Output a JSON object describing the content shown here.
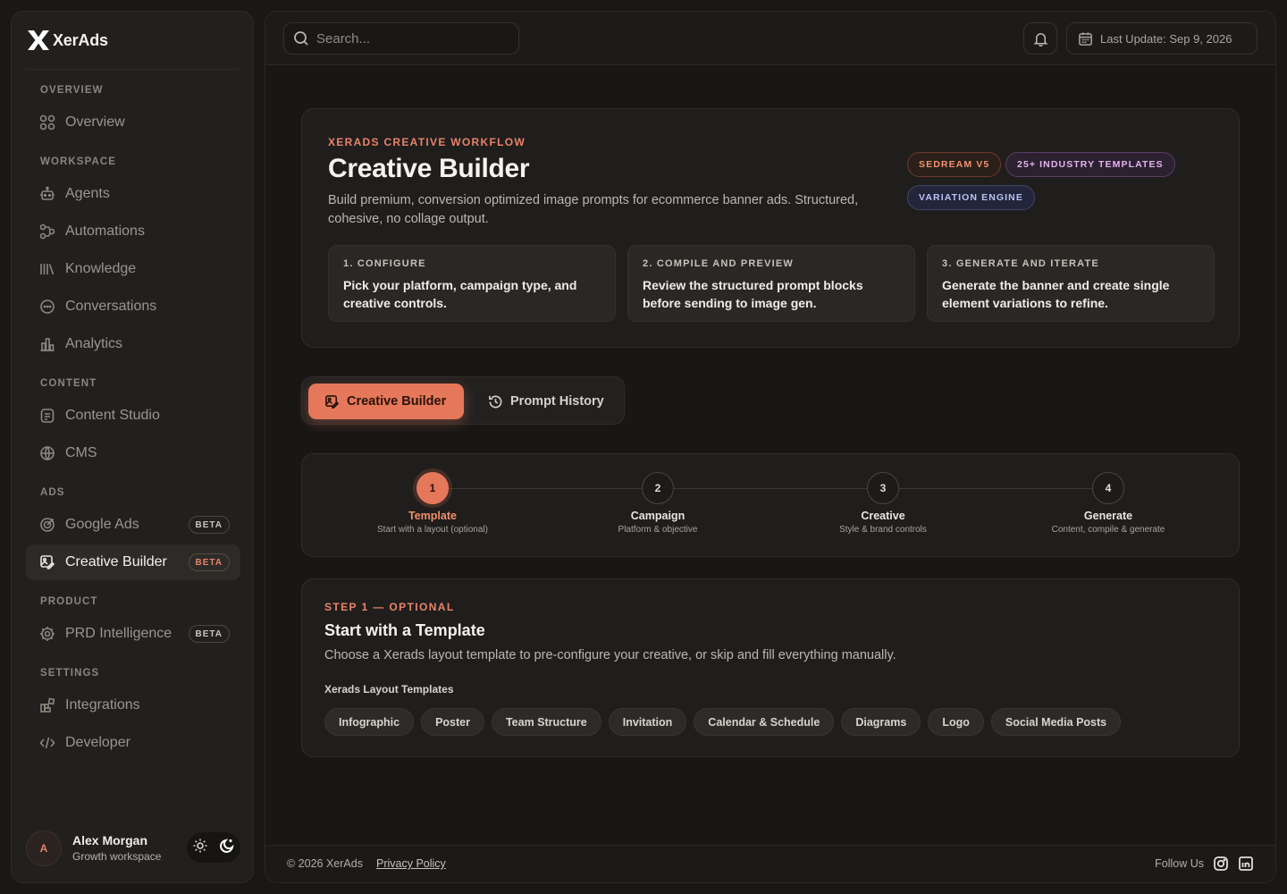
{
  "brand": {
    "name": "XerAds"
  },
  "sidebar": {
    "sections": {
      "overview": "OVERVIEW",
      "workspace": "WORKSPACE",
      "content": "CONTENT",
      "ads": "ADS",
      "product": "PRODUCT",
      "settings": "SETTINGS"
    },
    "items": {
      "overview": {
        "label": "Overview",
        "icon": "grid-icon"
      },
      "agents": {
        "label": "Agents",
        "icon": "bot-icon"
      },
      "automations": {
        "label": "Automations",
        "icon": "workflow-icon"
      },
      "knowledge": {
        "label": "Knowledge",
        "icon": "library-icon"
      },
      "conversations": {
        "label": "Conversations",
        "icon": "chat-icon"
      },
      "analytics": {
        "label": "Analytics",
        "icon": "chart-icon"
      },
      "content_studio": {
        "label": "Content Studio",
        "icon": "document-icon"
      },
      "cms": {
        "label": "CMS",
        "icon": "globe-icon"
      },
      "google_ads": {
        "label": "Google Ads",
        "icon": "target-icon",
        "badge": "BETA"
      },
      "creative_builder": {
        "label": "Creative Builder",
        "icon": "image-edit-icon",
        "badge": "BETA",
        "active": true
      },
      "prd_intelligence": {
        "label": "PRD Intelligence",
        "icon": "cog-icon",
        "badge": "BETA"
      },
      "integrations": {
        "label": "Integrations",
        "icon": "blocks-icon"
      },
      "developer": {
        "label": "Developer",
        "icon": "code-icon"
      }
    },
    "user": {
      "initial": "A",
      "name": "Alex Morgan",
      "workspace": "Growth workspace"
    }
  },
  "topbar": {
    "search_placeholder": "Search...",
    "last_update": "Last Update: Sep 9, 2026"
  },
  "hero": {
    "eyebrow": "XERADS CREATIVE WORKFLOW",
    "title": "Creative Builder",
    "description": "Build premium, conversion optimized image prompts for ecommerce banner ads. Structured, cohesive, no collage output.",
    "pills": [
      "SEDREAM V5",
      "25+ INDUSTRY TEMPLATES",
      "VARIATION ENGINE"
    ],
    "steps": [
      {
        "title": "1. CONFIGURE",
        "desc": "Pick your platform, campaign type, and creative controls."
      },
      {
        "title": "2. COMPILE AND PREVIEW",
        "desc": "Review the structured prompt blocks before sending to image gen."
      },
      {
        "title": "3. GENERATE AND ITERATE",
        "desc": "Generate the banner and create single element variations to refine."
      }
    ]
  },
  "tabs": {
    "active": "Creative Builder",
    "other": "Prompt History"
  },
  "stepper": [
    {
      "num": "1",
      "title": "Template",
      "sub": "Start with a layout (optional)"
    },
    {
      "num": "2",
      "title": "Campaign",
      "sub": "Platform & objective"
    },
    {
      "num": "3",
      "title": "Creative",
      "sub": "Style & brand controls"
    },
    {
      "num": "4",
      "title": "Generate",
      "sub": "Content, compile & generate"
    }
  ],
  "template_section": {
    "eyebrow": "STEP 1 — OPTIONAL",
    "title": "Start with a Template",
    "description": "Choose a Xerads layout template to pre-configure your creative, or skip and fill everything manually.",
    "label": "Xerads Layout Templates",
    "chips": [
      "Infographic",
      "Poster",
      "Team Structure",
      "Invitation",
      "Calendar & Schedule",
      "Diagrams",
      "Logo",
      "Social Media Posts"
    ]
  },
  "footer": {
    "copyright": "© 2026 XerAds",
    "privacy": "Privacy Policy",
    "follow": "Follow Us"
  },
  "colors": {
    "accent": "#e5785a",
    "background": "#181716",
    "panel": "#201e1c"
  }
}
